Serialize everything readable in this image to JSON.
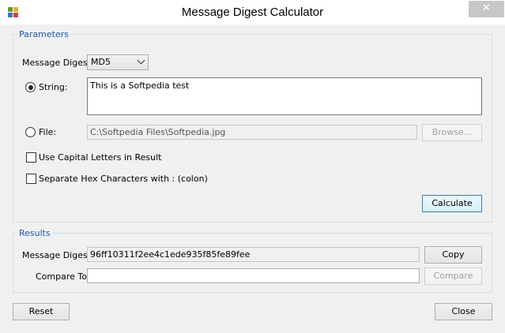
{
  "window": {
    "title": "Message Digest Calculator",
    "close_glyph": "✕",
    "app_icon": "app-icon"
  },
  "parameters": {
    "group_label": "Parameters",
    "digest_label": "Message Digest:",
    "digest_selected": "MD5",
    "string_label": "String:",
    "string_selected": true,
    "string_value": "This is a Softpedia test",
    "file_label": "File:",
    "file_selected": false,
    "file_value": "C:\\Softpedia Files\\Softpedia.jpg",
    "browse_label": "Browse...",
    "capital_label": "Use Capital Letters in Result",
    "capital_checked": false,
    "separate_label": "Separate Hex Characters with : (colon)",
    "separate_checked": false,
    "calculate_label": "Calculate"
  },
  "results": {
    "group_label": "Results",
    "digest_label": "Message Digest:",
    "digest_value": "96ff10311f2ee4c1ede935f85fe89fee",
    "copy_label": "Copy",
    "compare_to_label": "Compare To:",
    "compare_to_value": "",
    "compare_label": "Compare"
  },
  "footer": {
    "reset_label": "Reset",
    "close_label": "Close"
  },
  "colors": {
    "group_label": "#1e5ab4",
    "default_button_border": "#3c7fb1"
  }
}
